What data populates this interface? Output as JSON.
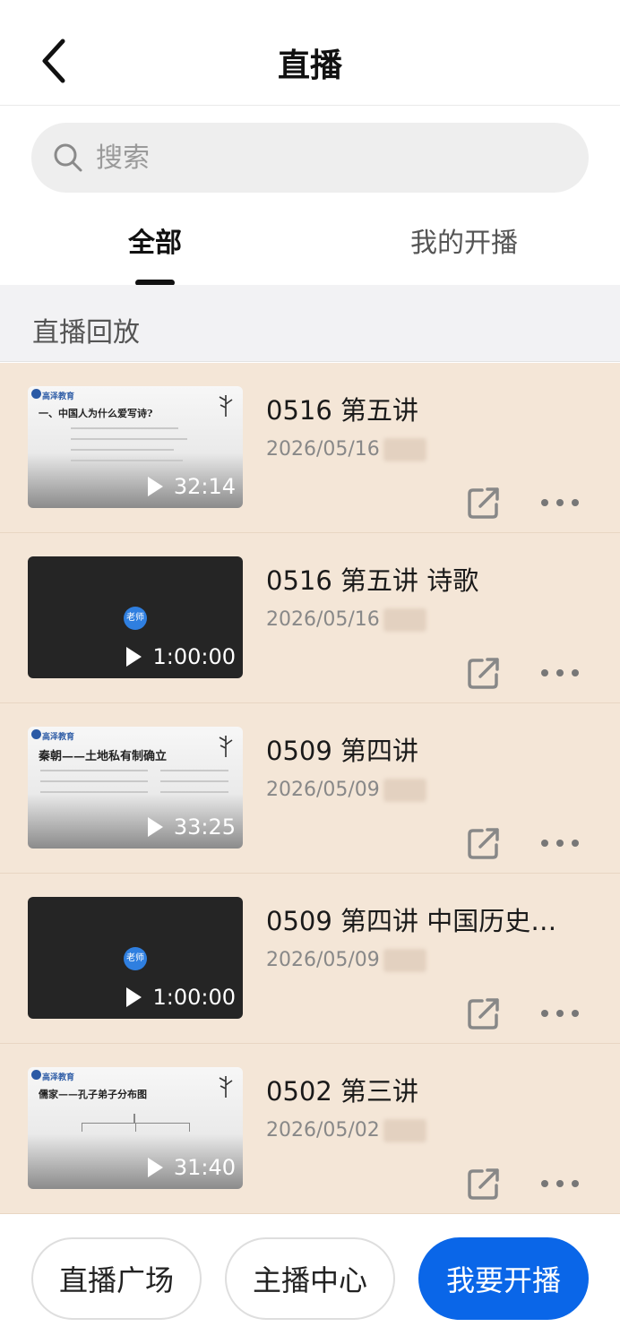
{
  "header": {
    "title": "直播"
  },
  "search": {
    "placeholder": "搜索"
  },
  "tabs": [
    {
      "label": "全部",
      "active": true
    },
    {
      "label": "我的开播",
      "active": false
    }
  ],
  "section": {
    "title": "直播回放"
  },
  "items": [
    {
      "title": "0516 第五讲",
      "date": "2026/05/16",
      "duration": "32:14",
      "thumb": "slide",
      "slide_heading": "一、中国人为什么爱写诗?"
    },
    {
      "title": "0516 第五讲 诗歌",
      "date": "2026/05/16",
      "duration": "1:00:00",
      "thumb": "dark",
      "badge": "老师"
    },
    {
      "title": "0509 第四讲",
      "date": "2026/05/09",
      "duration": "33:25",
      "thumb": "slide",
      "slide_heading": "秦朝——土地私有制确立"
    },
    {
      "title": "0509 第四讲 中国历史…",
      "date": "2026/05/09",
      "duration": "1:00:00",
      "thumb": "dark",
      "badge": "老师"
    },
    {
      "title": "0502 第三讲",
      "date": "2026/05/02",
      "duration": "31:40",
      "thumb": "slide",
      "slide_heading": "儒家——孔子弟子分布图"
    }
  ],
  "slide_brand": "高泽教育",
  "bottom": {
    "square": "直播广场",
    "center": "主播中心",
    "start": "我要开播"
  },
  "colors": {
    "list_bg": "#f4e6d7",
    "primary": "#0a66e8",
    "section_bg": "#f2f2f4"
  },
  "icons": {
    "back": "chevron-left-icon",
    "search": "search-icon",
    "share": "share-icon",
    "more": "more-dots-icon",
    "play": "play-icon"
  }
}
